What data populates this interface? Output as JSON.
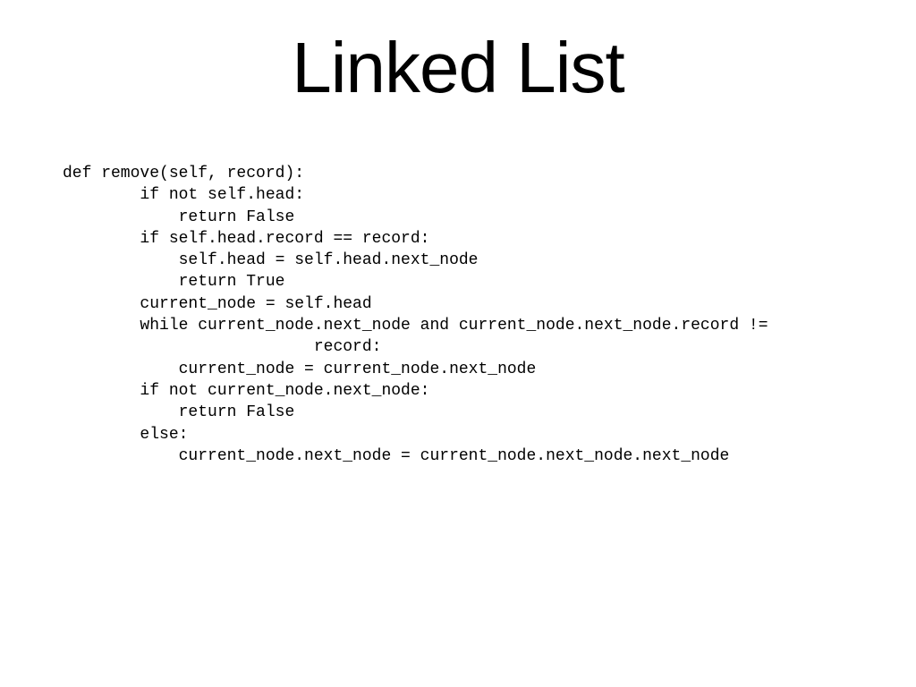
{
  "title": "Linked List",
  "code": {
    "line1": "def remove(self, record):",
    "line2": "        if not self.head:",
    "line3": "            return False",
    "line4": "        if self.head.record == record:",
    "line5": "            self.head = self.head.next_node",
    "line6": "            return True",
    "line7": "        current_node = self.head",
    "line8": "        while current_node.next_node and current_node.next_node.record !=",
    "line9": "                          record:",
    "line10": "            current_node = current_node.next_node",
    "line11": "        if not current_node.next_node:",
    "line12": "            return False",
    "line13": "        else:",
    "line14": "            current_node.next_node = current_node.next_node.next_node"
  }
}
